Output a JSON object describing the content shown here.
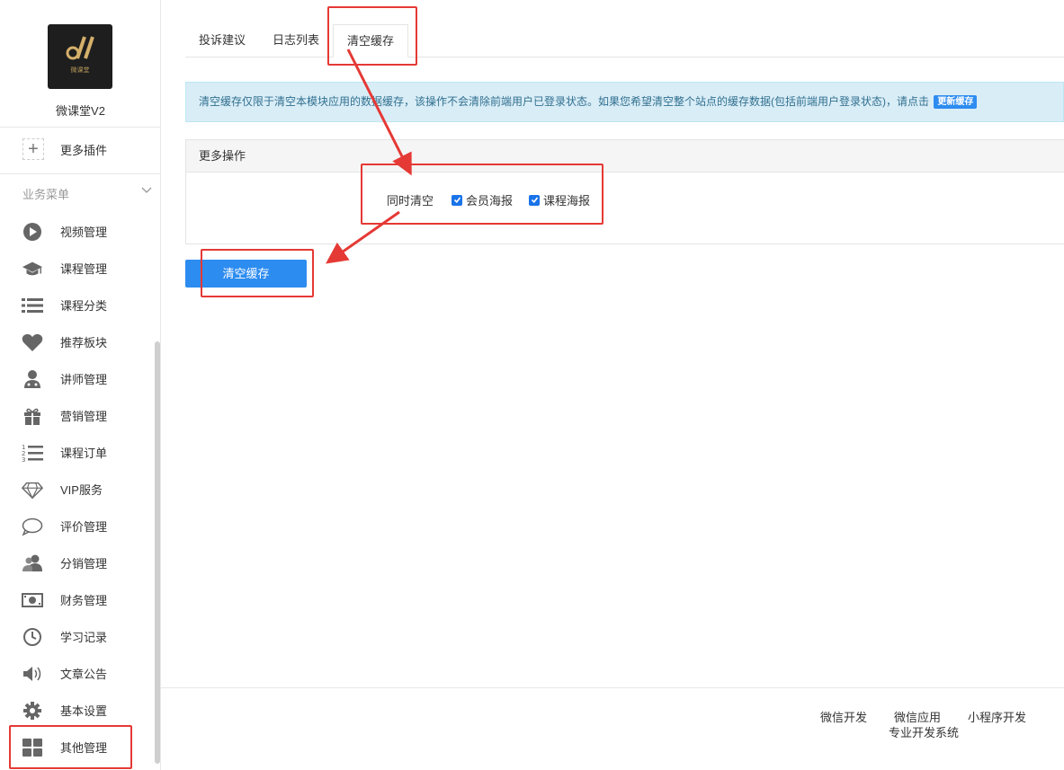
{
  "app": {
    "name": "微课堂V2",
    "logo_subtext": "微课堂"
  },
  "sidebar": {
    "more_plugins": "更多插件",
    "group_title": "业务菜单",
    "items": [
      {
        "label": "视频管理",
        "icon": "play-circle-icon"
      },
      {
        "label": "课程管理",
        "icon": "graduation-cap-icon"
      },
      {
        "label": "课程分类",
        "icon": "list-icon"
      },
      {
        "label": "推荐板块",
        "icon": "heart-icon"
      },
      {
        "label": "讲师管理",
        "icon": "teacher-icon"
      },
      {
        "label": "营销管理",
        "icon": "gift-icon"
      },
      {
        "label": "课程订单",
        "icon": "ordered-list-icon"
      },
      {
        "label": "VIP服务",
        "icon": "diamond-icon"
      },
      {
        "label": "评价管理",
        "icon": "comment-icon"
      },
      {
        "label": "分销管理",
        "icon": "users-icon"
      },
      {
        "label": "财务管理",
        "icon": "money-icon"
      },
      {
        "label": "学习记录",
        "icon": "clock-icon"
      },
      {
        "label": "文章公告",
        "icon": "volume-icon"
      },
      {
        "label": "基本设置",
        "icon": "gear-icon"
      },
      {
        "label": "其他管理",
        "icon": "grid-icon"
      }
    ]
  },
  "tabs": [
    {
      "label": "投诉建议",
      "active": false
    },
    {
      "label": "日志列表",
      "active": false
    },
    {
      "label": "清空缓存",
      "active": true
    }
  ],
  "alert": {
    "text": "清空缓存仅限于清空本模块应用的数据缓存，该操作不会清除前端用户已登录状态。如果您希望清空整个站点的缓存数据(包括前端用户登录状态)，请点击",
    "link_label": "更新缓存"
  },
  "panel": {
    "title": "更多操作",
    "option_label": "同时清空",
    "options": [
      {
        "label": "会员海报",
        "checked": true
      },
      {
        "label": "课程海报",
        "checked": true
      }
    ]
  },
  "submit_label": "清空缓存",
  "footer": {
    "links": [
      "微信开发",
      "微信应用",
      "小程序开发"
    ],
    "sub": "专业开发系统"
  },
  "colors": {
    "primary": "#2d8cf0",
    "annotation": "#e53935",
    "alert_bg": "#d9edf7",
    "alert_text": "#31708f"
  }
}
